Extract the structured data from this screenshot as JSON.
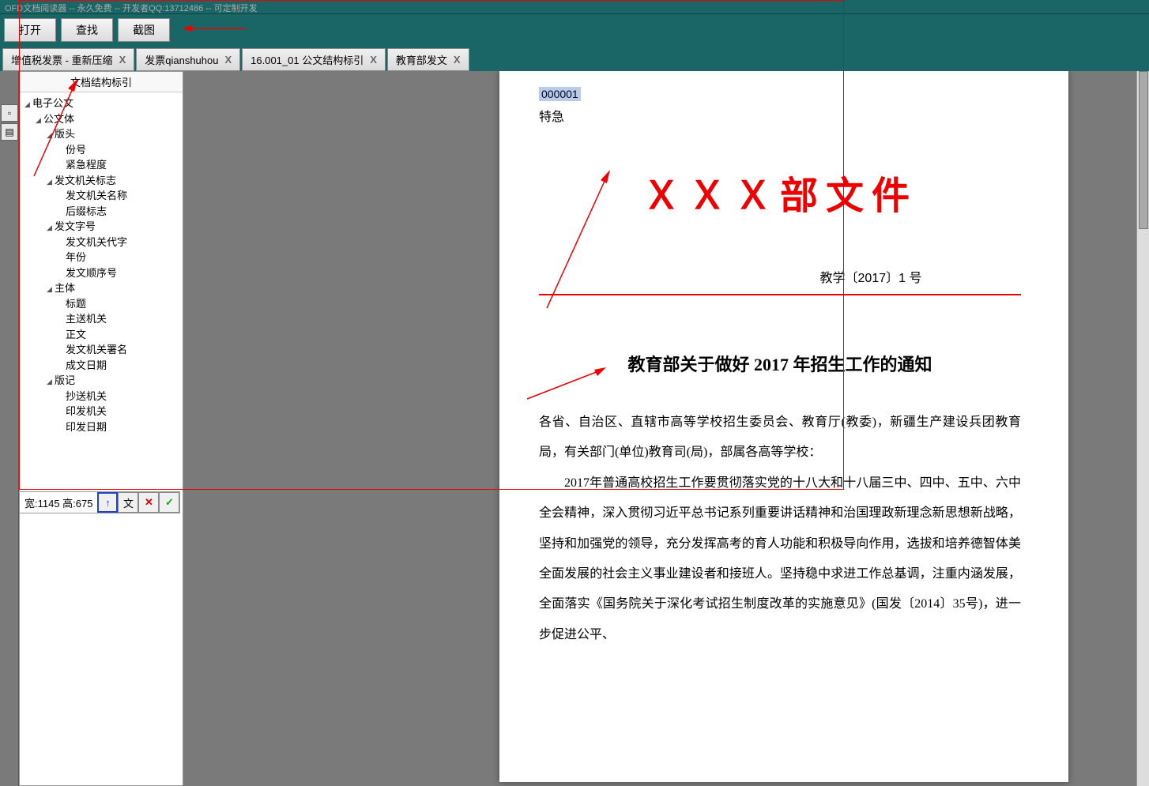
{
  "titlebar": "OFD文档阅读器 -- 永久免费 -- 开发者QQ:13712486 -- 可定制开发",
  "toolbar": {
    "open": "打开",
    "find": "查找",
    "screenshot": "截图"
  },
  "tabs": [
    {
      "label": "增值税发票 - 重新压缩"
    },
    {
      "label": "发票qianshuhou"
    },
    {
      "label": "16.001_01 公文结构标引"
    },
    {
      "label": "教育部发文"
    }
  ],
  "sidebar": {
    "header": "文档结构标引",
    "tree": [
      {
        "level": 0,
        "expand": true,
        "label": "电子公文"
      },
      {
        "level": 1,
        "expand": true,
        "label": "公文体"
      },
      {
        "level": 2,
        "expand": true,
        "label": "版头"
      },
      {
        "level": 3,
        "expand": false,
        "label": "份号"
      },
      {
        "level": 3,
        "expand": false,
        "label": "紧急程度"
      },
      {
        "level": 2,
        "expand": true,
        "label": "发文机关标志"
      },
      {
        "level": 3,
        "expand": false,
        "label": "发文机关名称"
      },
      {
        "level": 3,
        "expand": false,
        "label": "后缀标志"
      },
      {
        "level": 2,
        "expand": true,
        "label": "发文字号"
      },
      {
        "level": 3,
        "expand": false,
        "label": "发文机关代字"
      },
      {
        "level": 3,
        "expand": false,
        "label": "年份"
      },
      {
        "level": 3,
        "expand": false,
        "label": "发文顺序号"
      },
      {
        "level": 2,
        "expand": true,
        "label": "主体"
      },
      {
        "level": 3,
        "expand": false,
        "label": "标题"
      },
      {
        "level": 3,
        "expand": false,
        "label": "主送机关"
      },
      {
        "level": 3,
        "expand": false,
        "label": "正文"
      },
      {
        "level": 3,
        "expand": false,
        "label": "发文机关署名"
      },
      {
        "level": 3,
        "expand": false,
        "label": "成文日期"
      },
      {
        "level": 2,
        "expand": true,
        "label": "版记"
      },
      {
        "level": 3,
        "expand": false,
        "label": "抄送机关"
      },
      {
        "level": 3,
        "expand": false,
        "label": "印发机关"
      },
      {
        "level": 3,
        "expand": false,
        "label": "印发日期"
      }
    ]
  },
  "document": {
    "serial": "000001",
    "urgency": "特急",
    "big_title": "ＸＸＸ部文件",
    "doc_number": "教学〔2017〕1 号",
    "title": "教育部关于做好 2017 年招生工作的通知",
    "addressee": "各省、自治区、直辖市高等学校招生委员会、教育厅(教委)，新疆生产建设兵团教育局，有关部门(单位)教育司(局)，部属各高等学校：",
    "body_p1": "2017年普通高校招生工作要贯彻落实党的十八大和十八届三中、四中、五中、六中全会精神，深入贯彻习近平总书记系列重要讲话精神和治国理政新理念新思想新战略，坚持和加强党的领导，充分发挥高考的育人功能和积极导向作用，选拔和培养德智体美全面发展的社会主义事业建设者和接班人。坚持稳中求进工作总基调，注重内涵发展，全面落实《国务院关于深化考试招生制度改革的实施意见》(国发〔2014〕35号)，进一步促进公平、"
  },
  "screenshot": {
    "info": "宽:1145 高:675",
    "up": "↑",
    "text": "文",
    "cancel": "✕",
    "ok": "✓"
  }
}
